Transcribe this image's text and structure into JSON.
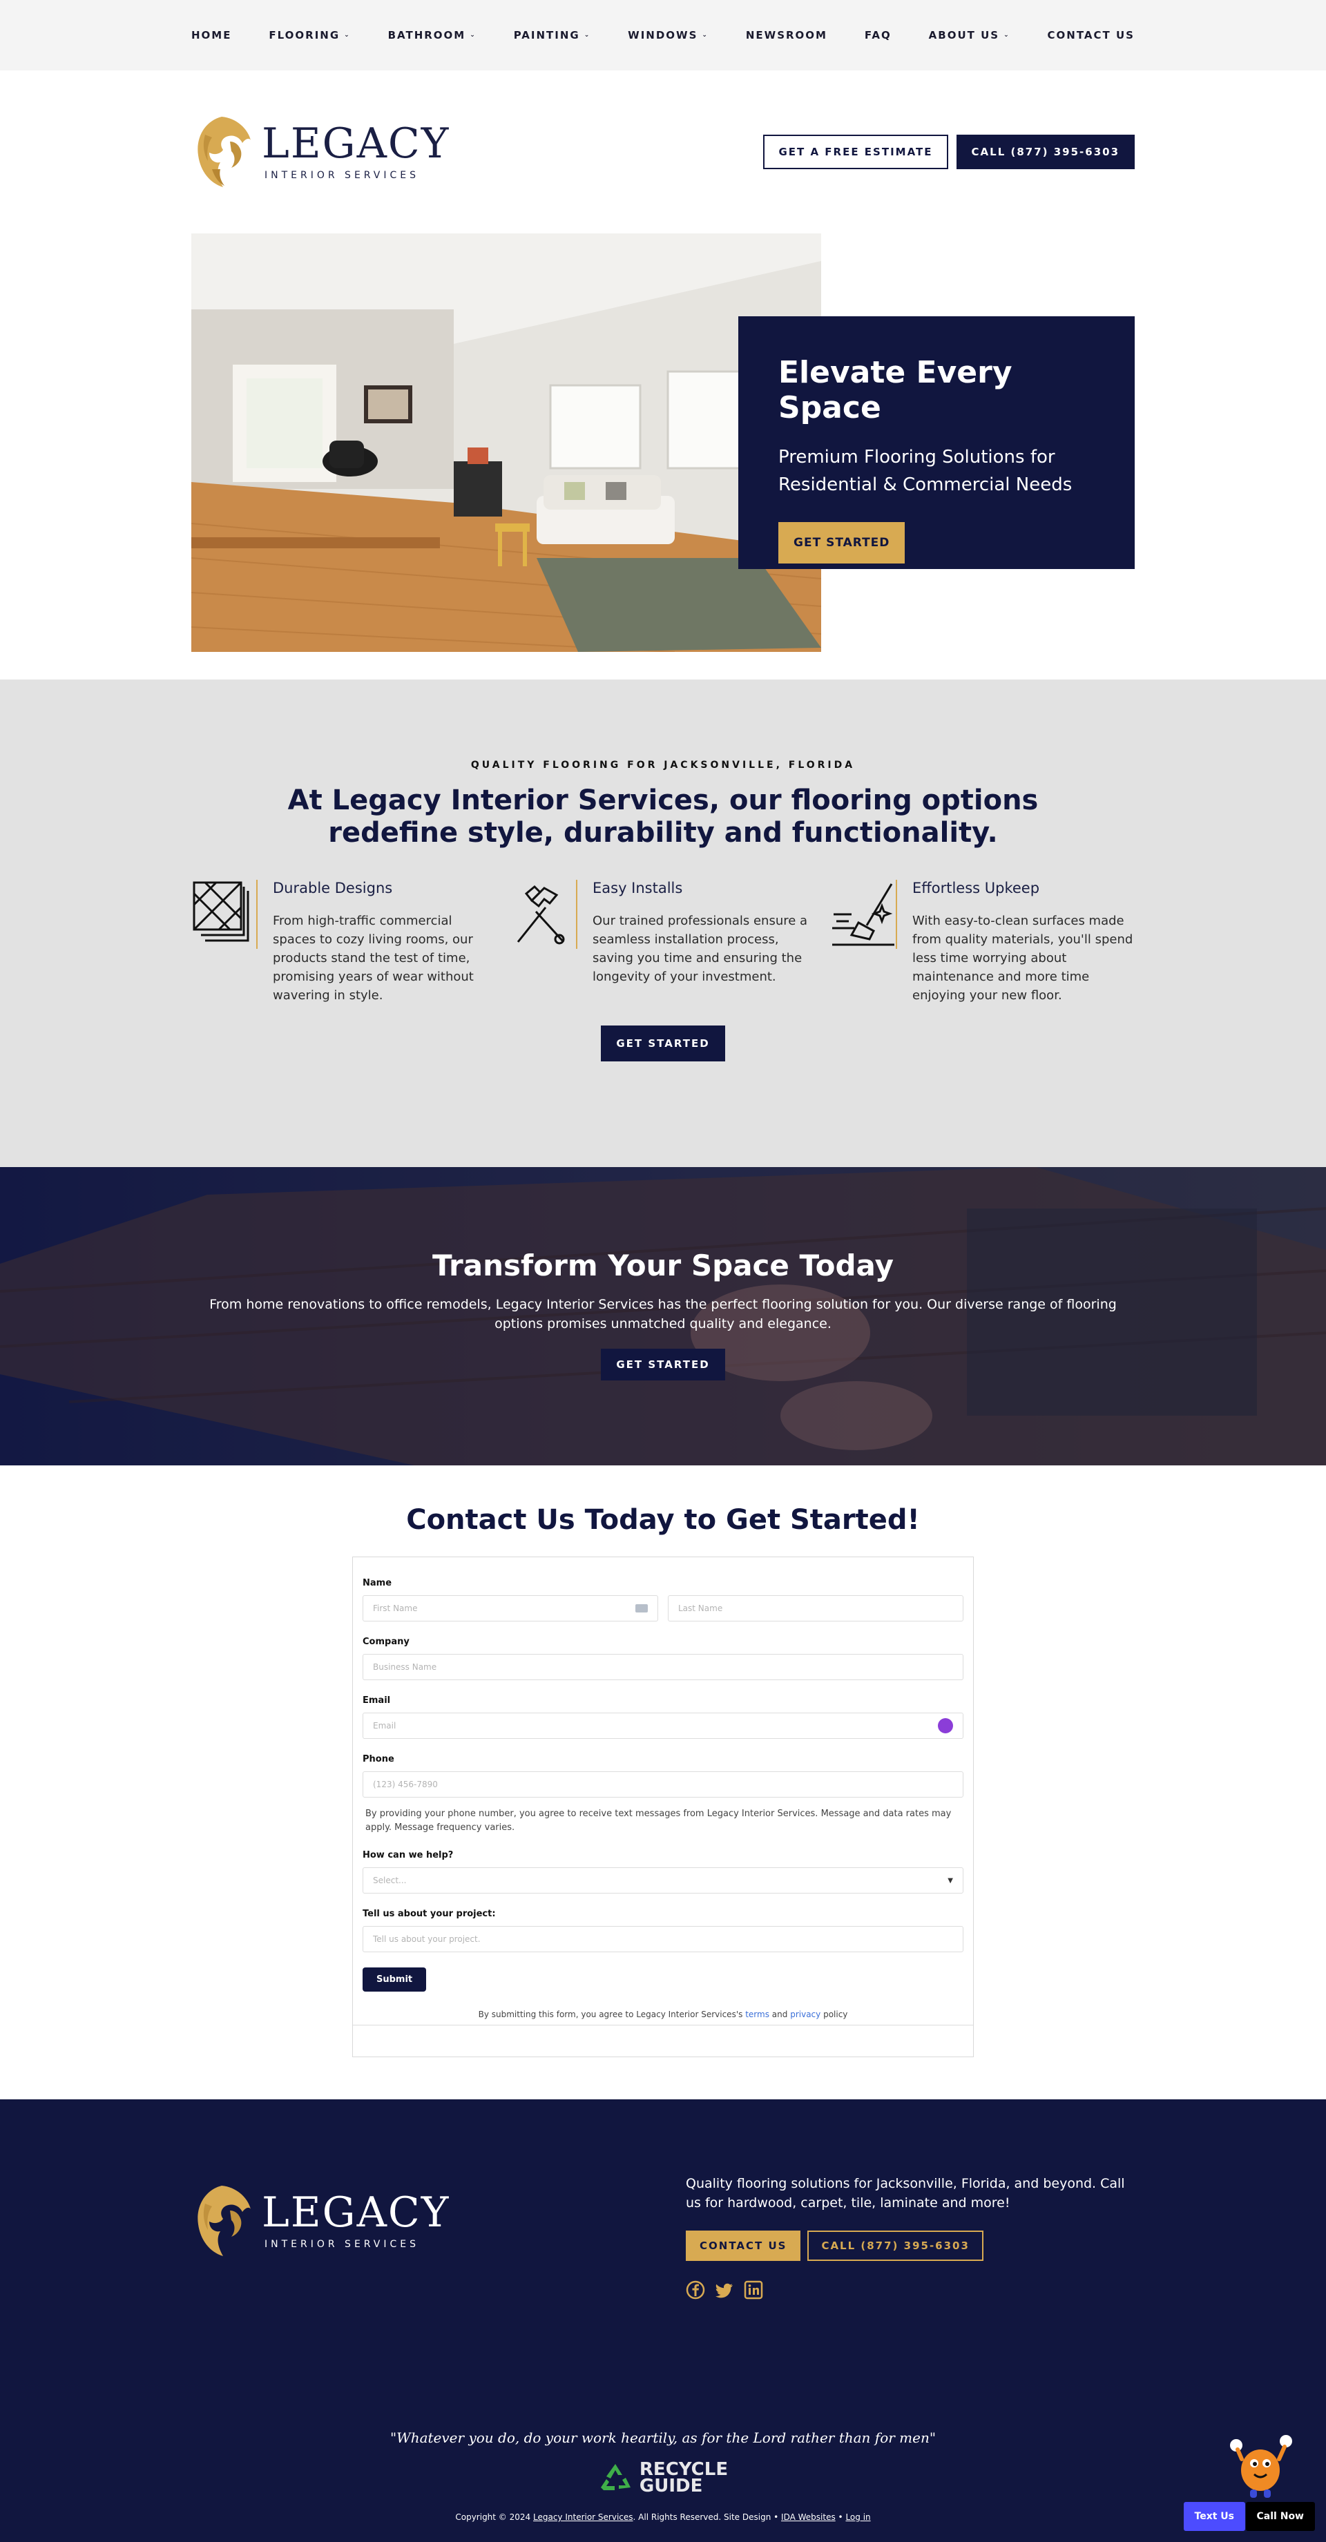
{
  "nav": {
    "items": [
      {
        "label": "HOME",
        "caret": false
      },
      {
        "label": "FLOORING",
        "caret": true
      },
      {
        "label": "BATHROOM",
        "caret": true
      },
      {
        "label": "PAINTING",
        "caret": true
      },
      {
        "label": "WINDOWS",
        "caret": true
      },
      {
        "label": "NEWSROOM",
        "caret": false
      },
      {
        "label": "FAQ",
        "caret": false
      },
      {
        "label": "ABOUT US",
        "caret": true
      },
      {
        "label": "CONTACT US",
        "caret": false
      }
    ]
  },
  "brand": {
    "name": "LEGACY",
    "tagline": "INTERIOR SERVICES",
    "colors": {
      "navy": "#11163f",
      "gold": "#d8aa52",
      "gray": "#e2e2e2"
    }
  },
  "header": {
    "estimate_label": "GET A FREE ESTIMATE",
    "call_label": "CALL (877) 395-6303"
  },
  "hero": {
    "title": "Elevate Every Space",
    "subtitle": "Premium Flooring Solutions for Residential & Commercial Needs",
    "cta": "GET STARTED"
  },
  "features": {
    "kicker": "QUALITY FLOORING FOR JACKSONVILLE, FLORIDA",
    "heading": "At Legacy Interior Services, our flooring options redefine style, durability and functionality.",
    "items": [
      {
        "icon": "tiles-icon",
        "title": "Durable Designs",
        "text": "From high-traffic commercial spaces to cozy living rooms, our products stand the test of time, promising years of wear without wavering in style."
      },
      {
        "icon": "hammer-icon",
        "title": "Easy Installs",
        "text": "Our trained professionals ensure a seamless installation process, saving you time and ensuring the longevity of your investment."
      },
      {
        "icon": "mop-icon",
        "title": "Effortless Upkeep",
        "text": "With easy-to-clean surfaces made from quality materials, you'll spend less time worrying about maintenance and more time enjoying your new floor."
      }
    ],
    "cta": "GET STARTED"
  },
  "transform": {
    "title": "Transform Your Space Today",
    "text": "From home renovations to office remodels, Legacy Interior Services has the perfect flooring solution for you. Our diverse range of flooring options promises unmatched quality and elegance.",
    "cta": "GET STARTED"
  },
  "contact": {
    "title": "Contact Us Today to Get Started!",
    "form": {
      "name_label": "Name",
      "first_placeholder": "First Name",
      "last_placeholder": "Last Name",
      "company_label": "Company",
      "company_placeholder": "Business Name",
      "email_label": "Email",
      "email_placeholder": "Email",
      "phone_label": "Phone",
      "phone_placeholder": "(123) 456-7890",
      "sms_note": "By providing your phone number, you agree to receive text messages from Legacy Interior Services. Message and data rates may apply. Message frequency varies.",
      "help_label": "How can we help?",
      "help_placeholder": "Select...",
      "project_label": "Tell us about your project:",
      "project_placeholder": "Tell us about your project.",
      "submit": "Submit",
      "policy_pre": "By submitting this form, you agree to Legacy Interior Services's",
      "policy_terms": "terms",
      "policy_and": "and",
      "policy_privacy": "privacy",
      "policy_post": "policy"
    }
  },
  "footer": {
    "blurb": "Quality flooring solutions for Jacksonville, Florida, and beyond. Call us for hardwood, carpet, tile, laminate and more!",
    "contact_btn": "CONTACT US",
    "call_btn": "CALL (877) 395-6303",
    "socials": [
      "facebook-icon",
      "twitter-icon",
      "linkedin-icon"
    ],
    "quote": "\"Whatever you do, do your work heartily, as for the Lord rather than for men\"",
    "badge_line1": "RECYCLE",
    "badge_line2": "GUIDE",
    "copyright_pre": "Copyright © 2024",
    "copyright_company": "Legacy Interior Services",
    "copyright_mid": ". All Rights Reserved. Site Design •",
    "copyright_design": "IDA Websites",
    "copyright_sep": "•",
    "copyright_login": "Log in"
  },
  "floating": {
    "text_us": "Text Us",
    "call_now": "Call Now"
  }
}
